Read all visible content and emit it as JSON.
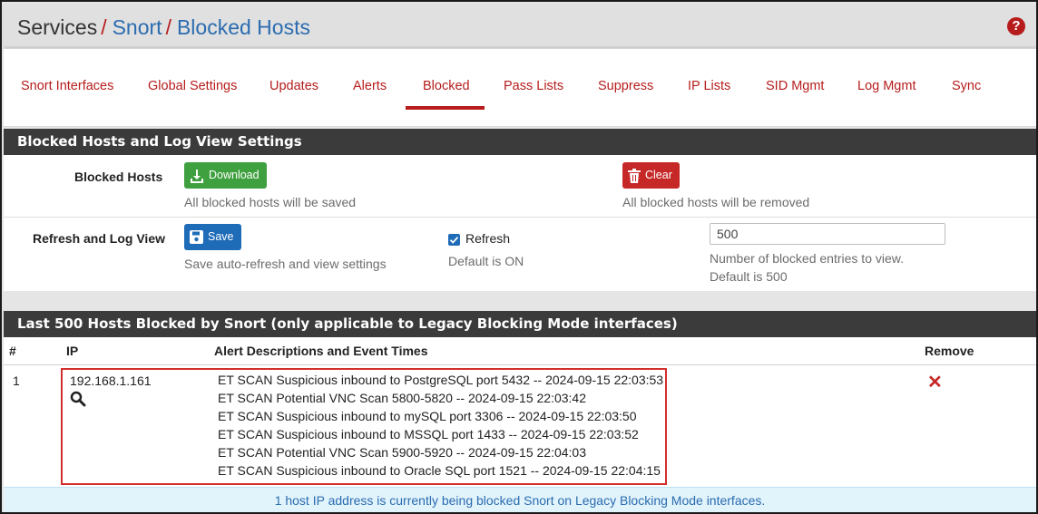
{
  "breadcrumb": {
    "first": "Services",
    "second": "Snort",
    "third": "Blocked Hosts",
    "separator": "/"
  },
  "tabs": [
    {
      "label": "Snort Interfaces"
    },
    {
      "label": "Global Settings"
    },
    {
      "label": "Updates"
    },
    {
      "label": "Alerts"
    },
    {
      "label": "Blocked",
      "active": true
    },
    {
      "label": "Pass Lists"
    },
    {
      "label": "Suppress"
    },
    {
      "label": "IP Lists"
    },
    {
      "label": "SID Mgmt"
    },
    {
      "label": "Log Mgmt"
    },
    {
      "label": "Sync"
    }
  ],
  "settings_panel": {
    "heading": "Blocked Hosts and Log View Settings",
    "blocked_hosts": {
      "label": "Blocked Hosts",
      "download_label": "Download",
      "download_help": "All blocked hosts will be saved",
      "clear_label": "Clear",
      "clear_help": "All blocked hosts will be removed"
    },
    "refresh_log": {
      "label": "Refresh and Log View",
      "save_label": "Save",
      "save_help": "Save auto-refresh and view settings",
      "refresh_label": "Refresh",
      "refresh_checked": true,
      "refresh_help": "Default is ON",
      "entries_value": "500",
      "entries_help_1": "Number of blocked entries to view.",
      "entries_help_2": "Default is 500"
    }
  },
  "blocked_panel": {
    "heading": "Last 500 Hosts Blocked by Snort (only applicable to Legacy Blocking Mode interfaces)",
    "columns": {
      "num": "#",
      "ip": "IP",
      "alerts": "Alert Descriptions and Event Times",
      "remove": "Remove"
    },
    "rows": [
      {
        "num": "1",
        "ip": "192.168.1.161",
        "alerts": [
          "ET SCAN Suspicious inbound to PostgreSQL port 5432 -- 2024-09-15 22:03:53",
          "ET SCAN Potential VNC Scan 5800-5820 -- 2024-09-15 22:03:42",
          "ET SCAN Suspicious inbound to mySQL port 3306 -- 2024-09-15 22:03:50",
          "ET SCAN Suspicious inbound to MSSQL port 1433 -- 2024-09-15 22:03:52",
          "ET SCAN Potential VNC Scan 5900-5920 -- 2024-09-15 22:04:03",
          "ET SCAN Suspicious inbound to Oracle SQL port 1521 -- 2024-09-15 22:04:15"
        ]
      }
    ],
    "footer": "1 host IP address is currently being blocked Snort on Legacy Blocking Mode interfaces."
  },
  "icons": {
    "help": "question-circle-icon",
    "download": "download-icon",
    "clear": "trash-icon",
    "save": "save-icon",
    "lookup": "search-icon",
    "remove": "times-icon"
  },
  "colors": {
    "accent_red": "#b71c1c",
    "link_blue": "#2b6cb0",
    "panel_heading": "#3b3b3b",
    "btn_green": "#3fa03f",
    "btn_red": "#c62828",
    "btn_blue": "#1e6bb8",
    "info_bg": "#e1f3fb"
  }
}
